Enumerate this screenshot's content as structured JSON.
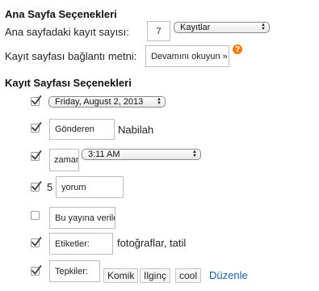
{
  "home_options": {
    "title": "Ana Sayfa Seçenekleri",
    "posts_count_label": "Ana sayfadaki kayıt sayısı:",
    "posts_count_value": "7",
    "posts_unit_select": "Kayıtlar",
    "post_link_label": "Kayıt sayfası bağlantı metni:",
    "post_link_value": "Devamını okuyun »",
    "help_icon_glyph": "?"
  },
  "post_options": {
    "title": "Kayıt Sayfası Seçenekleri",
    "date_select": "Friday, August 2, 2013",
    "sender_field": "Gönderen",
    "sender_name": "Nabilah",
    "time_field": "zaman",
    "time_select": "3:11 AM",
    "comment_count": "5",
    "comments_field": "yorum",
    "share_field": "Bu yayına verile",
    "labels_field": "Etiketler:",
    "labels_value": "fotoğraflar, tatil",
    "reactions_field": "Tepkiler:",
    "reactions": [
      "Komik",
      "Ilginç",
      "cool"
    ],
    "edit_link": "Düzenle"
  },
  "checkboxes": {
    "date": true,
    "sender": true,
    "time": true,
    "comments": true,
    "share": false,
    "labels": true,
    "reactions": true
  },
  "colors": {
    "help_icon": "#f07d10",
    "link": "#1f5fae",
    "checkmark": "#3a3a3a"
  }
}
